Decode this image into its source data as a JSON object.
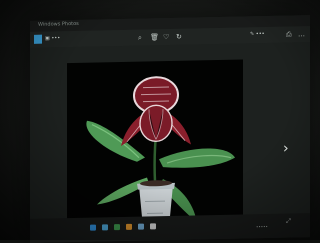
{
  "window": {
    "app_title": "Windows Photos",
    "left_label": "▣ •••",
    "right_label": "✎ •••",
    "toolbar_icons": [
      "zoom-icon",
      "delete-icon",
      "favorite-icon",
      "rotate-icon",
      "edit-icon",
      "share-icon",
      "print-icon",
      "more-icon"
    ],
    "next_arrow": "›",
    "expand_icon": "⤢",
    "clock": "•••••"
  },
  "photo": {
    "subject": "Paphiopedilum orchid in a small plastic pot",
    "icons": [
      "orchid-flower",
      "green-leaves",
      "plastic-pot"
    ]
  },
  "colors": {
    "accent": "#3aa0d8",
    "flower_maroon": "#8a1f2c",
    "leaf_green": "#4f9a56"
  }
}
